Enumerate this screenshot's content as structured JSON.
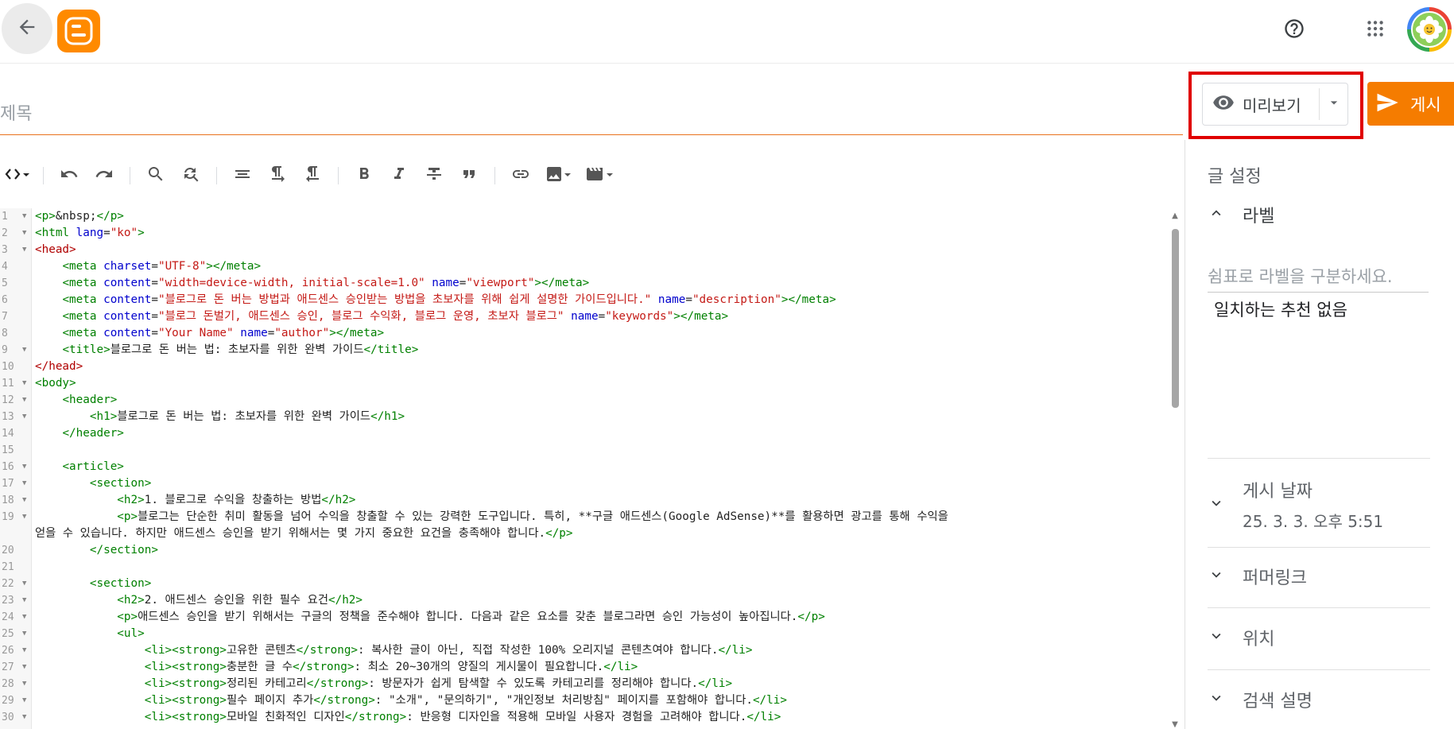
{
  "header": {
    "back_icon": "arrow-left-icon",
    "logo_icon": "blogger-logo",
    "help_icon": "help-circle-icon",
    "apps_icon": "apps-grid-icon",
    "avatar_icon": "flower-avatar",
    "brand_color": "#ff8a00"
  },
  "post": {
    "title_placeholder": "제목",
    "preview_label": "미리보기",
    "publish_label": "게시",
    "accent_color": "#f57c00"
  },
  "toolbar": {
    "items": [
      {
        "name": "html-view-toggle",
        "icon": "code-icon"
      },
      {
        "name": "undo-button",
        "icon": "undo-icon"
      },
      {
        "name": "redo-button",
        "icon": "redo-icon"
      },
      {
        "name": "search-button",
        "icon": "search-icon"
      },
      {
        "name": "replace-button",
        "icon": "find-replace-icon"
      },
      {
        "name": "format-button",
        "icon": "format-align-icon"
      },
      {
        "name": "ltr-button",
        "icon": "pilcrow-ltr-icon"
      },
      {
        "name": "rtl-button",
        "icon": "pilcrow-rtl-icon"
      },
      {
        "name": "bold-button",
        "icon": "bold-icon"
      },
      {
        "name": "italic-button",
        "icon": "italic-icon"
      },
      {
        "name": "strikethrough-button",
        "icon": "strikethrough-icon"
      },
      {
        "name": "quote-button",
        "icon": "quote-icon"
      },
      {
        "name": "link-button",
        "icon": "link-icon"
      },
      {
        "name": "image-button",
        "icon": "image-icon"
      },
      {
        "name": "video-button",
        "icon": "video-icon"
      }
    ]
  },
  "editor": {
    "lines": [
      {
        "n": "1",
        "fold": true,
        "tokens": [
          {
            "t": "tag",
            "v": "<p>"
          },
          {
            "t": "text",
            "v": "&nbsp;"
          },
          {
            "t": "tag",
            "v": "</p>"
          }
        ]
      },
      {
        "n": "2",
        "fold": true,
        "tokens": [
          {
            "t": "tag",
            "v": "<html "
          },
          {
            "t": "attr",
            "v": "lang"
          },
          {
            "t": "text",
            "v": "="
          },
          {
            "t": "str",
            "v": "\"ko\""
          },
          {
            "t": "tag",
            "v": ">"
          }
        ]
      },
      {
        "n": "3",
        "fold": true,
        "tokens": [
          {
            "t": "head",
            "v": "<head>"
          }
        ]
      },
      {
        "n": "4",
        "fold": false,
        "tokens": [
          {
            "t": "text",
            "v": "    "
          },
          {
            "t": "tag",
            "v": "<meta "
          },
          {
            "t": "attr",
            "v": "charset"
          },
          {
            "t": "text",
            "v": "="
          },
          {
            "t": "str",
            "v": "\"UTF-8\""
          },
          {
            "t": "tag",
            "v": "></meta>"
          }
        ]
      },
      {
        "n": "5",
        "fold": false,
        "tokens": [
          {
            "t": "text",
            "v": "    "
          },
          {
            "t": "tag",
            "v": "<meta "
          },
          {
            "t": "attr",
            "v": "content"
          },
          {
            "t": "text",
            "v": "="
          },
          {
            "t": "str",
            "v": "\"width=device-width, initial-scale=1.0\""
          },
          {
            "t": "text",
            "v": " "
          },
          {
            "t": "attr",
            "v": "name"
          },
          {
            "t": "text",
            "v": "="
          },
          {
            "t": "str",
            "v": "\"viewport\""
          },
          {
            "t": "tag",
            "v": "></meta>"
          }
        ]
      },
      {
        "n": "6",
        "fold": false,
        "tokens": [
          {
            "t": "text",
            "v": "    "
          },
          {
            "t": "tag",
            "v": "<meta "
          },
          {
            "t": "attr",
            "v": "content"
          },
          {
            "t": "text",
            "v": "="
          },
          {
            "t": "str",
            "v": "\"블로그로 돈 버는 방법과 애드센스 승인받는 방법을 초보자를 위해 쉽게 설명한 가이드입니다.\""
          },
          {
            "t": "text",
            "v": " "
          },
          {
            "t": "attr",
            "v": "name"
          },
          {
            "t": "text",
            "v": "="
          },
          {
            "t": "str",
            "v": "\"description\""
          },
          {
            "t": "tag",
            "v": "></meta>"
          }
        ]
      },
      {
        "n": "7",
        "fold": false,
        "tokens": [
          {
            "t": "text",
            "v": "    "
          },
          {
            "t": "tag",
            "v": "<meta "
          },
          {
            "t": "attr",
            "v": "content"
          },
          {
            "t": "text",
            "v": "="
          },
          {
            "t": "str",
            "v": "\"블로그 돈벌기, 애드센스 승인, 블로그 수익화, 블로그 운영, 초보자 블로그\""
          },
          {
            "t": "text",
            "v": " "
          },
          {
            "t": "attr",
            "v": "name"
          },
          {
            "t": "text",
            "v": "="
          },
          {
            "t": "str",
            "v": "\"keywords\""
          },
          {
            "t": "tag",
            "v": "></meta>"
          }
        ]
      },
      {
        "n": "8",
        "fold": false,
        "tokens": [
          {
            "t": "text",
            "v": "    "
          },
          {
            "t": "tag",
            "v": "<meta "
          },
          {
            "t": "attr",
            "v": "content"
          },
          {
            "t": "text",
            "v": "="
          },
          {
            "t": "str",
            "v": "\"Your Name\""
          },
          {
            "t": "text",
            "v": " "
          },
          {
            "t": "attr",
            "v": "name"
          },
          {
            "t": "text",
            "v": "="
          },
          {
            "t": "str",
            "v": "\"author\""
          },
          {
            "t": "tag",
            "v": "></meta>"
          }
        ]
      },
      {
        "n": "9",
        "fold": true,
        "tokens": [
          {
            "t": "text",
            "v": "    "
          },
          {
            "t": "tag",
            "v": "<title>"
          },
          {
            "t": "text",
            "v": "블로그로 돈 버는 법: 초보자를 위한 완벽 가이드"
          },
          {
            "t": "tag",
            "v": "</title>"
          }
        ]
      },
      {
        "n": "10",
        "fold": false,
        "tokens": [
          {
            "t": "head",
            "v": "</head>"
          }
        ]
      },
      {
        "n": "11",
        "fold": true,
        "tokens": [
          {
            "t": "tag",
            "v": "<body>"
          }
        ]
      },
      {
        "n": "12",
        "fold": true,
        "tokens": [
          {
            "t": "text",
            "v": "    "
          },
          {
            "t": "tag",
            "v": "<header>"
          }
        ]
      },
      {
        "n": "13",
        "fold": true,
        "tokens": [
          {
            "t": "text",
            "v": "        "
          },
          {
            "t": "tag",
            "v": "<h1>"
          },
          {
            "t": "text",
            "v": "블로그로 돈 버는 법: 초보자를 위한 완벽 가이드"
          },
          {
            "t": "tag",
            "v": "</h1>"
          }
        ]
      },
      {
        "n": "14",
        "fold": false,
        "tokens": [
          {
            "t": "text",
            "v": "    "
          },
          {
            "t": "tag",
            "v": "</header>"
          }
        ]
      },
      {
        "n": "15",
        "fold": false,
        "tokens": []
      },
      {
        "n": "16",
        "fold": true,
        "tokens": [
          {
            "t": "text",
            "v": "    "
          },
          {
            "t": "tag",
            "v": "<article>"
          }
        ]
      },
      {
        "n": "17",
        "fold": true,
        "tokens": [
          {
            "t": "text",
            "v": "        "
          },
          {
            "t": "tag",
            "v": "<section>"
          }
        ]
      },
      {
        "n": "18",
        "fold": true,
        "tokens": [
          {
            "t": "text",
            "v": "            "
          },
          {
            "t": "tag",
            "v": "<h2>"
          },
          {
            "t": "text",
            "v": "1. 블로그로 수익을 창출하는 방법"
          },
          {
            "t": "tag",
            "v": "</h2>"
          }
        ]
      },
      {
        "n": "19",
        "fold": true,
        "tokens": [
          {
            "t": "text",
            "v": "            "
          },
          {
            "t": "tag",
            "v": "<p>"
          },
          {
            "t": "text",
            "v": "블로그는 단순한 취미 활동을 넘어 수익을 창출할 수 있는 강력한 도구입니다. 특히, **구글 애드센스(Google AdSense)**를 활용하면 광고를 통해 수익을"
          }
        ]
      },
      {
        "n": "",
        "fold": false,
        "tokens": [
          {
            "t": "text",
            "v": "얻을 수 있습니다. 하지만 애드센스 승인을 받기 위해서는 몇 가지 중요한 요건을 충족해야 합니다."
          },
          {
            "t": "tag",
            "v": "</p>"
          }
        ]
      },
      {
        "n": "20",
        "fold": false,
        "tokens": [
          {
            "t": "text",
            "v": "        "
          },
          {
            "t": "tag",
            "v": "</section>"
          }
        ]
      },
      {
        "n": "21",
        "fold": false,
        "tokens": []
      },
      {
        "n": "22",
        "fold": true,
        "tokens": [
          {
            "t": "text",
            "v": "        "
          },
          {
            "t": "tag",
            "v": "<section>"
          }
        ]
      },
      {
        "n": "23",
        "fold": true,
        "tokens": [
          {
            "t": "text",
            "v": "            "
          },
          {
            "t": "tag",
            "v": "<h2>"
          },
          {
            "t": "text",
            "v": "2. 애드센스 승인을 위한 필수 요건"
          },
          {
            "t": "tag",
            "v": "</h2>"
          }
        ]
      },
      {
        "n": "24",
        "fold": true,
        "tokens": [
          {
            "t": "text",
            "v": "            "
          },
          {
            "t": "tag",
            "v": "<p>"
          },
          {
            "t": "text",
            "v": "애드센스 승인을 받기 위해서는 구글의 정책을 준수해야 합니다. 다음과 같은 요소를 갖춘 블로그라면 승인 가능성이 높아집니다."
          },
          {
            "t": "tag",
            "v": "</p>"
          }
        ]
      },
      {
        "n": "25",
        "fold": true,
        "tokens": [
          {
            "t": "text",
            "v": "            "
          },
          {
            "t": "tag",
            "v": "<ul>"
          }
        ]
      },
      {
        "n": "26",
        "fold": true,
        "tokens": [
          {
            "t": "text",
            "v": "                "
          },
          {
            "t": "tag",
            "v": "<li><strong>"
          },
          {
            "t": "text",
            "v": "고유한 콘텐츠"
          },
          {
            "t": "tag",
            "v": "</strong>"
          },
          {
            "t": "text",
            "v": ": 복사한 글이 아닌, 직접 작성한 100% 오리지널 콘텐츠여야 합니다."
          },
          {
            "t": "tag",
            "v": "</li>"
          }
        ]
      },
      {
        "n": "27",
        "fold": true,
        "tokens": [
          {
            "t": "text",
            "v": "                "
          },
          {
            "t": "tag",
            "v": "<li><strong>"
          },
          {
            "t": "text",
            "v": "충분한 글 수"
          },
          {
            "t": "tag",
            "v": "</strong>"
          },
          {
            "t": "text",
            "v": ": 최소 20~30개의 양질의 게시물이 필요합니다."
          },
          {
            "t": "tag",
            "v": "</li>"
          }
        ]
      },
      {
        "n": "28",
        "fold": true,
        "tokens": [
          {
            "t": "text",
            "v": "                "
          },
          {
            "t": "tag",
            "v": "<li><strong>"
          },
          {
            "t": "text",
            "v": "정리된 카테고리"
          },
          {
            "t": "tag",
            "v": "</strong>"
          },
          {
            "t": "text",
            "v": ": 방문자가 쉽게 탐색할 수 있도록 카테고리를 정리해야 합니다."
          },
          {
            "t": "tag",
            "v": "</li>"
          }
        ]
      },
      {
        "n": "29",
        "fold": true,
        "tokens": [
          {
            "t": "text",
            "v": "                "
          },
          {
            "t": "tag",
            "v": "<li><strong>"
          },
          {
            "t": "text",
            "v": "필수 페이지 추가"
          },
          {
            "t": "tag",
            "v": "</strong>"
          },
          {
            "t": "text",
            "v": ": \"소개\", \"문의하기\", \"개인정보 처리방침\" 페이지를 포함해야 합니다."
          },
          {
            "t": "tag",
            "v": "</li>"
          }
        ]
      },
      {
        "n": "30",
        "fold": true,
        "tokens": [
          {
            "t": "text",
            "v": "                "
          },
          {
            "t": "tag",
            "v": "<li><strong>"
          },
          {
            "t": "text",
            "v": "모바일 친화적인 디자인"
          },
          {
            "t": "tag",
            "v": "</strong>"
          },
          {
            "t": "text",
            "v": ": 반응형 디자인을 적용해 모바일 사용자 경험을 고려해야 합니다."
          },
          {
            "t": "tag",
            "v": "</li>"
          }
        ]
      }
    ]
  },
  "side_panel": {
    "title": "글 설정",
    "labels": {
      "heading": "라벨",
      "input_placeholder": "쉼표로 라벨을 구분하세요.",
      "no_match": "일치하는 추천 없음"
    },
    "publish_date": {
      "heading": "게시 날짜",
      "value": "25. 3. 3. 오후 5:51"
    },
    "permalink": {
      "heading": "퍼머링크"
    },
    "location": {
      "heading": "위치"
    },
    "search_description": {
      "heading": "검색 설명"
    }
  }
}
